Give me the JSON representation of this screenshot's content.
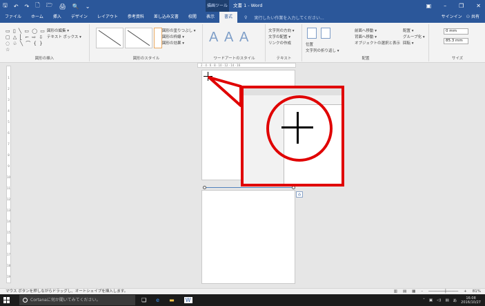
{
  "title_bar": {
    "qat_icons": [
      "save-icon",
      "undo-icon",
      "redo-icon",
      "new-icon",
      "open-icon",
      "print-icon",
      "preview-icon",
      "customize-icon"
    ],
    "qat_glyphs": [
      "🖫",
      "↶",
      "↷",
      "🗋",
      "🗁",
      "🖨",
      "🔍",
      "⌄"
    ],
    "context_tool": "描画ツール",
    "document_title": "文書 1 - Word",
    "window_glyphs": [
      "▣",
      "–",
      "❐",
      "✕"
    ],
    "signin": "サインイン",
    "share": "共有"
  },
  "tabs": [
    "ファイル",
    "ホーム",
    "挿入",
    "デザイン",
    "レイアウト",
    "参考資料",
    "差し込み文書",
    "校閲",
    "表示",
    "書式"
  ],
  "active_tab": "書式",
  "tell_me": "実行したい作業を入力してください...",
  "ribbon": {
    "insert_shapes": {
      "label": "図形の挿入",
      "shapes_rows": [
        "▭ ▯ ╲ ▭ ◯ ▭",
        "▢ △ ⎣ ⌐ ⇨ ⇩",
        "◌ ♧ ╲ ⌒ { } ☆"
      ],
      "commands": [
        "図形の編集 ▾",
        "テキスト ボックス ▾"
      ]
    },
    "shape_styles": {
      "label": "図形のスタイル",
      "commands": [
        "図形の塗りつぶし ▾",
        "図形の枠線 ▾",
        "図形の効果 ▾"
      ]
    },
    "wordart_styles": {
      "label": "ワードアートのスタイル",
      "glyph": "A"
    },
    "text": {
      "label": "テキスト",
      "commands": [
        "文字列の方向 ▾",
        "文字の配置 ▾",
        "リンクの作成"
      ]
    },
    "arrange": {
      "label": "配置",
      "buttons": [
        "位置",
        "文字列の折り返し ▾"
      ],
      "commands": [
        "前面へ移動 ▾",
        "背面へ移動 ▾",
        "オブジェクトの選択と表示",
        "配置 ▾",
        "グループ化 ▾",
        "回転 ▾"
      ]
    },
    "size": {
      "label": "サイズ",
      "height": "0 mm",
      "width": "85.3 mm"
    }
  },
  "rulers": {
    "horizontal_ticks": "2 · 4 · 6 · 8 · 10 · 12 · 14 · 16",
    "vertical_ticks": [
      "1",
      "2",
      "3",
      "4",
      "5",
      "6",
      "7",
      "8",
      "9",
      "10",
      "11",
      "12",
      "13",
      "14",
      "15",
      "16",
      "17",
      "18",
      "19"
    ]
  },
  "status_bar": {
    "message": "マウス ボタンを押しながらドラッグし、オートシェイプを挿入します。",
    "zoom": "81%"
  },
  "taskbar": {
    "cortana_placeholder": "Cortanaに何か聞いてみてください。",
    "time": "16:08",
    "date": "2016/10/27",
    "ime": "あ"
  }
}
